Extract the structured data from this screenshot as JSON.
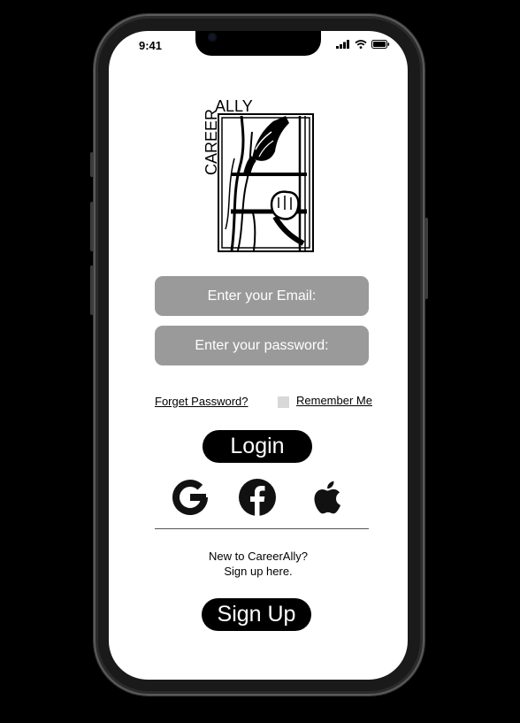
{
  "status_bar": {
    "time": "9:41"
  },
  "logo": {
    "word1": "CAREER",
    "word2": "ALLY"
  },
  "form": {
    "email_placeholder": "Enter your Email:",
    "password_placeholder": "Enter your password:",
    "forget_password": "Forget Password?",
    "remember_me": "Remember Me",
    "remember_checked": false
  },
  "buttons": {
    "login": "Login",
    "signup": "Sign Up"
  },
  "social": [
    "google-icon",
    "facebook-icon",
    "apple-icon"
  ],
  "signup_prompt": {
    "line1": "New to CareerAlly?",
    "line2": "Sign up here."
  }
}
